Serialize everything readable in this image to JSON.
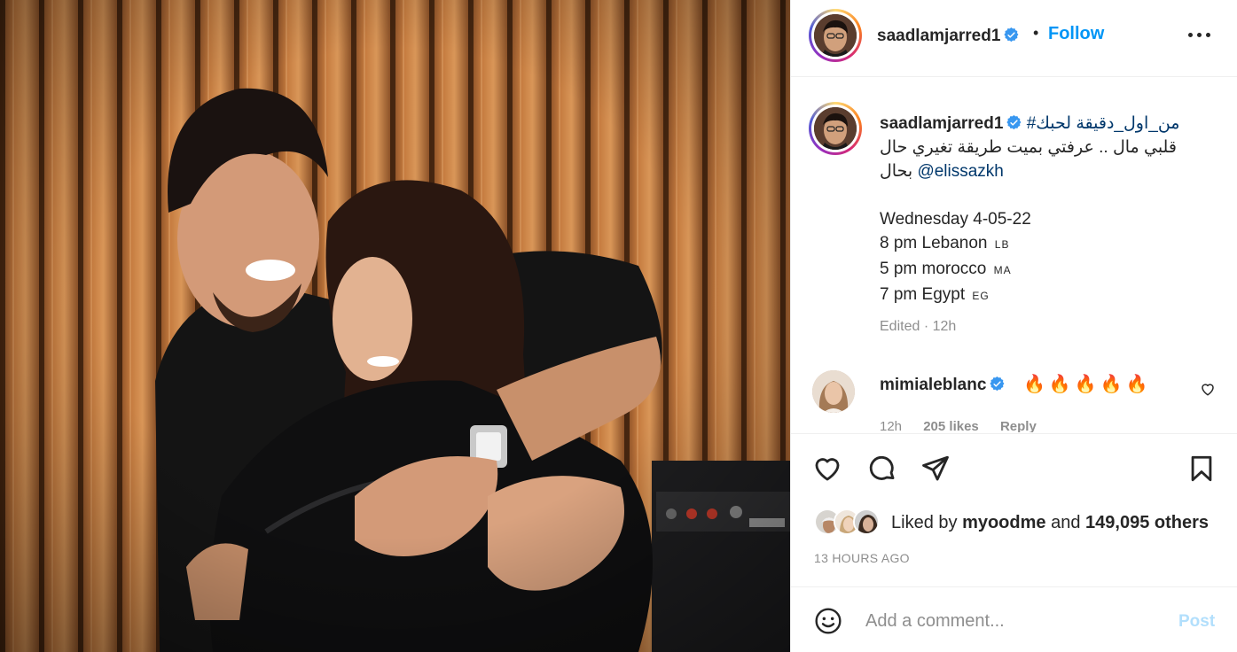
{
  "post": {
    "username": "saadlamjarred1",
    "follow_label": "Follow",
    "separator": "•"
  },
  "caption": {
    "username": "saadlamjarred1",
    "hashtag": "من_اول_دقيقة لحبك#",
    "line2": "قلبي مال .. عرفتي بميت طريقة تغيري حال",
    "line3_text": "بحال",
    "mention": "@elissazkh",
    "date_line": "Wednesday 4-05-22",
    "times": [
      {
        "text": "8 pm Lebanon",
        "flag": "LB"
      },
      {
        "text": "5 pm morocco",
        "flag": "MA"
      },
      {
        "text": "7 pm Egypt",
        "flag": "EG"
      }
    ],
    "edited": "Edited · 12h"
  },
  "comment": {
    "username": "mimialeblanc",
    "text": "🔥🔥🔥🔥🔥",
    "age": "12h",
    "likes": "205 likes",
    "reply": "Reply"
  },
  "likes": {
    "prefix": "Liked by",
    "user": "myoodme",
    "middle": "and",
    "others": "149,095 others"
  },
  "timestamp": "13 HOURS AGO",
  "add_comment": {
    "placeholder": "Add a comment...",
    "post_label": "Post"
  },
  "icons": [
    "more-options-icon",
    "verified-badge-icon",
    "like-icon",
    "comment-icon",
    "share-icon",
    "save-icon",
    "emoji-icon",
    "comment-like-icon"
  ],
  "colors": {
    "link": "#0095f6",
    "hashtag": "#00376b",
    "muted": "#8e8e8e",
    "post_disabled": "#b2dffc"
  }
}
